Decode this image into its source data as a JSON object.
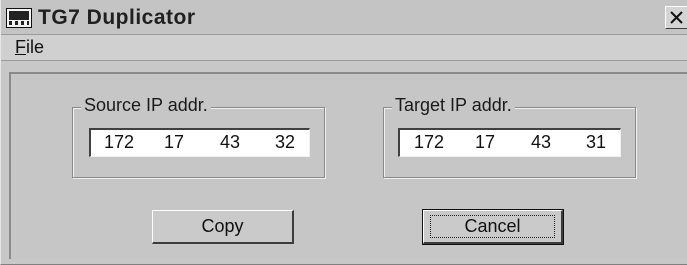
{
  "window": {
    "title": "TG7 Duplicator",
    "app_icon": "duplicator-app-icon",
    "close_icon": "close-icon"
  },
  "menubar": {
    "items": [
      {
        "label_mnemonic": "F",
        "label_rest": "ile",
        "label": "File"
      }
    ]
  },
  "source": {
    "label": "Source IP addr.",
    "octets": [
      "172",
      "17",
      "43",
      "32"
    ]
  },
  "target": {
    "label": "Target IP addr.",
    "octets": [
      "172",
      "17",
      "43",
      "31"
    ]
  },
  "buttons": {
    "copy_label": "Copy",
    "cancel_label": "Cancel"
  }
}
